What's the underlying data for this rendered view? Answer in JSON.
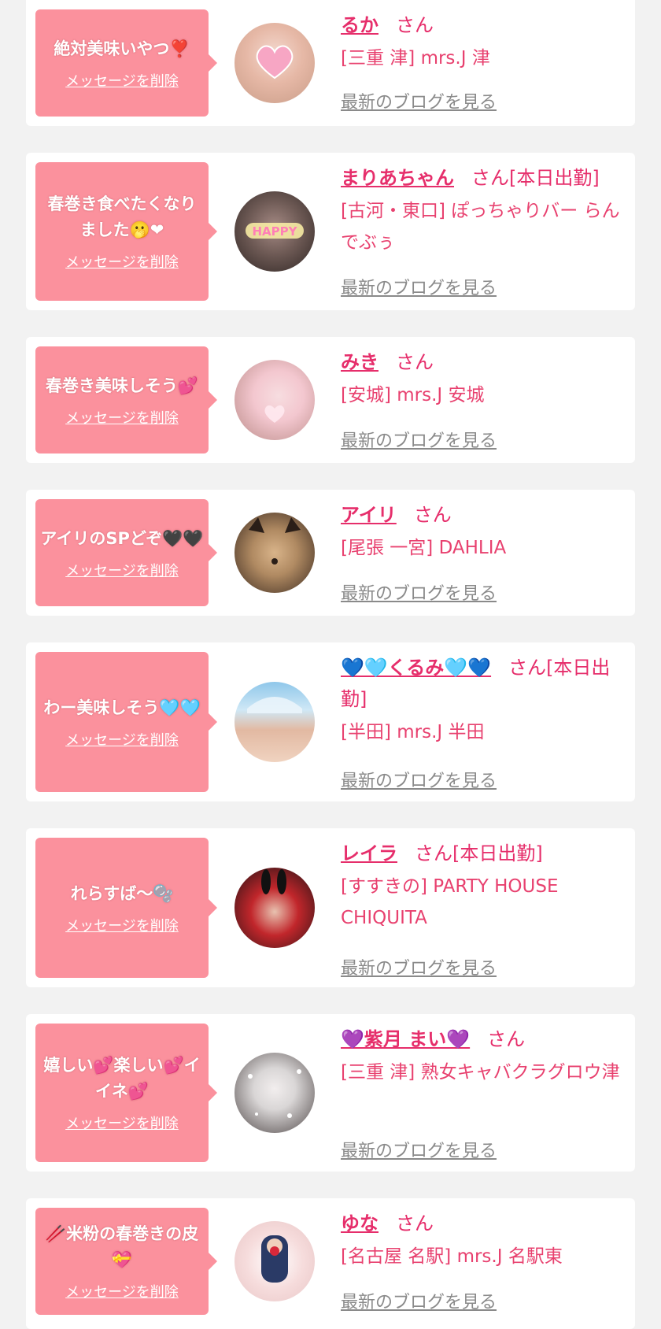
{
  "messages": [
    {
      "comment": "絶対美味いやつ❣️",
      "delete_label": "メッセージを削除",
      "name": "るか",
      "honorific": "さん",
      "status": "",
      "shop": "[三重 津] mrs.J 津",
      "blog_label": "最新のブログを見る",
      "avatar_colors": [
        "#f4d9cf",
        "#c99d88"
      ]
    },
    {
      "comment": "春巻き食べたくなりました🫢❤",
      "delete_label": "メッセージを削除",
      "name": "まりあちゃん",
      "honorific": "さん",
      "status": "[本日出勤]",
      "shop": "[古河・東口] ぽっちゃりバー らんでぶぅ",
      "blog_label": "最新のブログを見る",
      "avatar_colors": [
        "#6e5a55",
        "#2f2624"
      ]
    },
    {
      "comment": "春巻き美味しそう💕",
      "delete_label": "メッセージを削除",
      "name": "みき",
      "honorific": "さん",
      "status": "",
      "shop": "[安城] mrs.J 安城",
      "blog_label": "最新のブログを見る",
      "avatar_colors": [
        "#f3c7cf",
        "#b98a86"
      ]
    },
    {
      "comment": "アイリのSPどぞ🖤🖤",
      "delete_label": "メッセージを削除",
      "name": "アイリ",
      "honorific": "さん",
      "status": "",
      "shop": "[尾張 一宮] DAHLIA",
      "blog_label": "最新のブログを見る",
      "avatar_colors": [
        "#b08a62",
        "#3b2a20"
      ]
    },
    {
      "comment": "わー美味しそう🩵🩵",
      "delete_label": "メッセージを削除",
      "name": "💙🩵くるみ🩵💙",
      "honorific": "さん",
      "status": "[本日出勤]",
      "shop": "[半田] mrs.J 半田",
      "blog_label": "最新のブログを見る",
      "avatar_colors": [
        "#8fc7ea",
        "#e2b9a2"
      ]
    },
    {
      "comment": "れらすば〜🫧",
      "delete_label": "メッセージを削除",
      "name": "レイラ",
      "honorific": "さん",
      "status": "[本日出勤]",
      "shop": "[すすきの] PARTY HOUSE CHIQUITA",
      "blog_label": "最新のブログを見る",
      "avatar_colors": [
        "#c1262b",
        "#1d1214"
      ]
    },
    {
      "comment": "嬉しい💕楽しい💕イイネ💕",
      "delete_label": "メッセージを削除",
      "name": "💜紫月 まい💜",
      "honorific": "さん",
      "status": "",
      "shop": "[三重 津] 熟女キャバクラグロウ津",
      "blog_label": "最新のブログを見る",
      "avatar_colors": [
        "#d9d6d6",
        "#504848"
      ]
    },
    {
      "comment": "🥢米粉の春巻きの皮💝",
      "delete_label": "メッセージを削除",
      "name": "ゆな",
      "honorific": "さん",
      "status": "",
      "shop": "[名古屋 名駅] mrs.J 名駅東",
      "blog_label": "最新のブログを見る",
      "avatar_colors": [
        "#f6dcdc",
        "#2a3a66"
      ]
    }
  ]
}
